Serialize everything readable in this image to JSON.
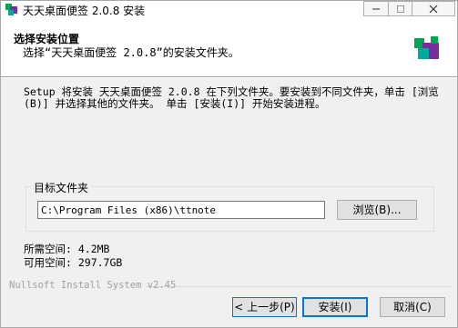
{
  "window": {
    "title": "天天桌面便签 2.0.8 安装"
  },
  "header": {
    "title": "选择安装位置",
    "subtitle": "选择“天天桌面便签 2.0.8”的安装文件夹。"
  },
  "description": "Setup 将安装 天天桌面便签 2.0.8 在下列文件夹。要安装到不同文件夹，单击 [浏览(B)] 并选择其他的文件夹。 单击 [安装(I)] 开始安装进程。",
  "destination": {
    "group_label": "目标文件夹",
    "path": "C:\\Program Files (x86)\\ttnote",
    "browse_label": "浏览(B)..."
  },
  "space": {
    "required": "所需空间: 4.2MB",
    "available": "可用空间: 297.7GB"
  },
  "branding": "Nullsoft Install System v2.45",
  "buttons": {
    "back": "< 上一步(P)",
    "install": "安装(I)",
    "cancel": "取消(C)"
  },
  "colors": {
    "focus_border": "#0078d7",
    "logo_green": "#00a651",
    "logo_purple": "#7b2c9e",
    "logo_teal": "#00a99d"
  }
}
